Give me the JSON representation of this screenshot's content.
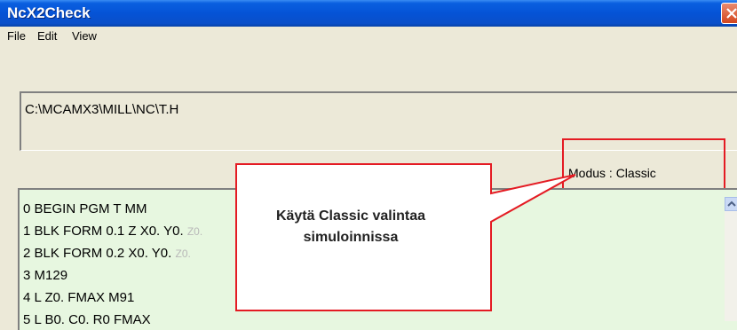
{
  "window": {
    "title": "NcX2Check"
  },
  "menu": [
    {
      "label": "File"
    },
    {
      "label": "Edit"
    },
    {
      "label": "View"
    }
  ],
  "path_field": {
    "value": "C:\\MCAMX3\\MILL\\NC\\T.H"
  },
  "modus": {
    "label": "Modus : Classic"
  },
  "code_lines": [
    {
      "text": "0 BEGIN PGM  T MM",
      "faded": ""
    },
    {
      "text": "1 BLK FORM 0.1 Z X0.  Y0.",
      "faded": "Z0."
    },
    {
      "text": "2 BLK FORM 0.2  X0.  Y0.",
      "faded": "Z0."
    },
    {
      "text": "3 M129",
      "faded": ""
    },
    {
      "text": "4 L Z0.  FMAX M91",
      "faded": ""
    },
    {
      "text": "5 L B0.  C0.  R0 FMAX",
      "faded": ""
    }
  ],
  "callout": {
    "line1": "Käytä Classic valintaa",
    "line2": "simuloinnissa"
  },
  "colors": {
    "titlebar": "#0553d6",
    "highlight": "#e41b23",
    "code_background": "#e7f7e0"
  },
  "icons": [
    "close-icon",
    "scroll-up-arrow-icon"
  ]
}
